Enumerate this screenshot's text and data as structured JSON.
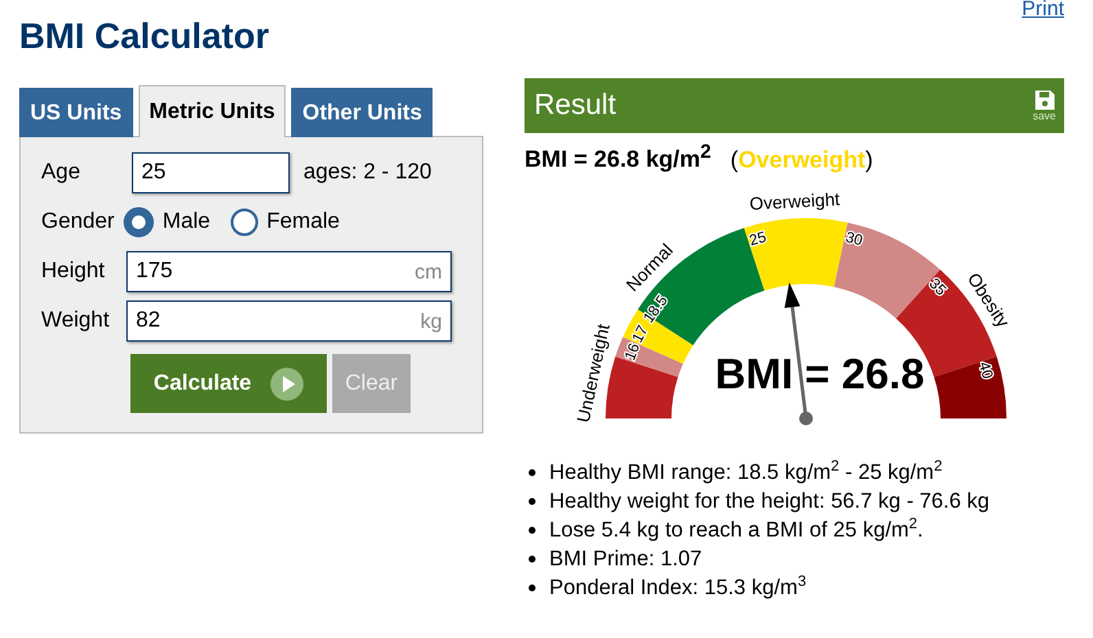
{
  "title": "BMI Calculator",
  "print_link": "Print",
  "tabs": [
    {
      "label": "US Units",
      "selected": false
    },
    {
      "label": "Metric Units",
      "selected": true
    },
    {
      "label": "Other Units",
      "selected": false
    }
  ],
  "form": {
    "age": {
      "label": "Age",
      "value": "25",
      "hint": "ages: 2 - 120"
    },
    "gender": {
      "label": "Gender",
      "options": [
        {
          "label": "Male",
          "selected": true
        },
        {
          "label": "Female",
          "selected": false
        }
      ]
    },
    "measures": [
      {
        "label": "Height",
        "value": "175",
        "unit": "cm"
      },
      {
        "label": "Weight",
        "value": "82",
        "unit": "kg"
      }
    ],
    "buttons": {
      "calculate": "Calculate",
      "clear": "Clear"
    }
  },
  "result": {
    "header": "Result",
    "save_label": "save",
    "summary": "BMI = 26.8 kg/m$^{2}$",
    "category_open": "(",
    "category": "Overweight",
    "category_close": ")",
    "gauge": {
      "reading": "BMI = 26.8",
      "segments": [
        {
          "color": "#bc2020"
        },
        {
          "color": "#d38888"
        },
        {
          "color": "#ffe400"
        },
        {
          "color": "#008137"
        },
        {
          "color": "#ffe400"
        },
        {
          "color": "#d38888"
        },
        {
          "color": "#bc2020"
        },
        {
          "color": "#8a0101"
        }
      ],
      "ticks": [
        "16",
        "17",
        "18.5",
        "25",
        "30",
        "35",
        "40"
      ],
      "zones": [
        "Underweight",
        "Normal",
        "Overweight",
        "Obesity"
      ]
    },
    "facts": [
      "Healthy BMI range: 18.5 kg/m$^{2}$ - 25 kg/m$^{2}$",
      "Healthy weight for the height: 56.7 kg - 76.6 kg",
      "Lose 5.4 kg to reach a BMI of 25 kg/m$^{2}$.",
      "BMI Prime: 1.07",
      "Ponderal Index: 15.3 kg/m$^{3}$"
    ]
  }
}
